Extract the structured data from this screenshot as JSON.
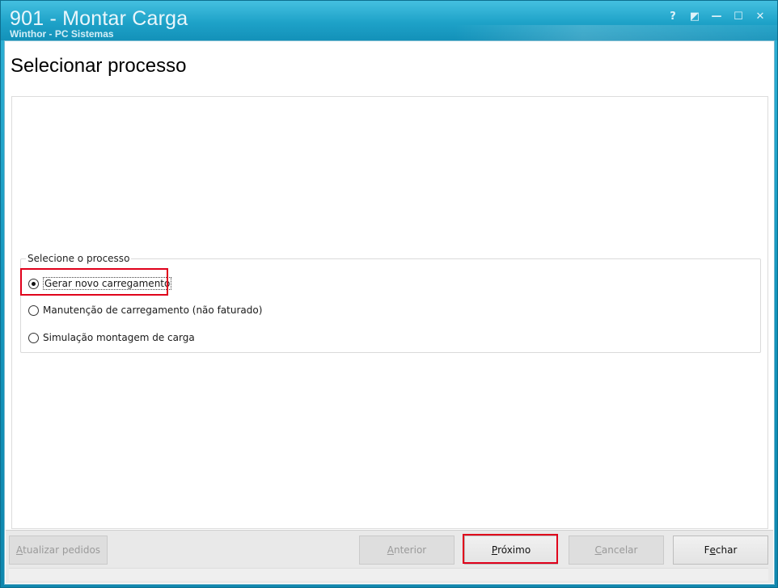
{
  "window": {
    "title": "901 - Montar Carga",
    "subtitle": "Winthor - PC Sistemas",
    "controls": {
      "help": "?",
      "restore_alt": "◩",
      "minimize": "—",
      "maximize": "☐",
      "close": "✕"
    }
  },
  "page": {
    "title": "Selecionar processo"
  },
  "process_group": {
    "legend": "Selecione o processo",
    "options": [
      {
        "label": "Gerar novo carregamento",
        "selected": true
      },
      {
        "label": "Manutenção de carregamento (não faturado)",
        "selected": false
      },
      {
        "label": "Simulação montagem de carga",
        "selected": false
      }
    ]
  },
  "footer": {
    "update_orders": {
      "mnemonic": "A",
      "rest": "tualizar pedidos",
      "enabled": false
    },
    "previous": {
      "mnemonic": "A",
      "rest": "nterior",
      "enabled": false
    },
    "next": {
      "mnemonic": "P",
      "rest": "róximo",
      "enabled": true
    },
    "cancel": {
      "mnemonic": "C",
      "rest": "ancelar",
      "enabled": false
    },
    "close": {
      "pre": "F",
      "mnemonic": "e",
      "rest": "char",
      "enabled": true
    }
  },
  "colors": {
    "titlebar": "#1ea2c8",
    "highlight": "#e0001b"
  }
}
